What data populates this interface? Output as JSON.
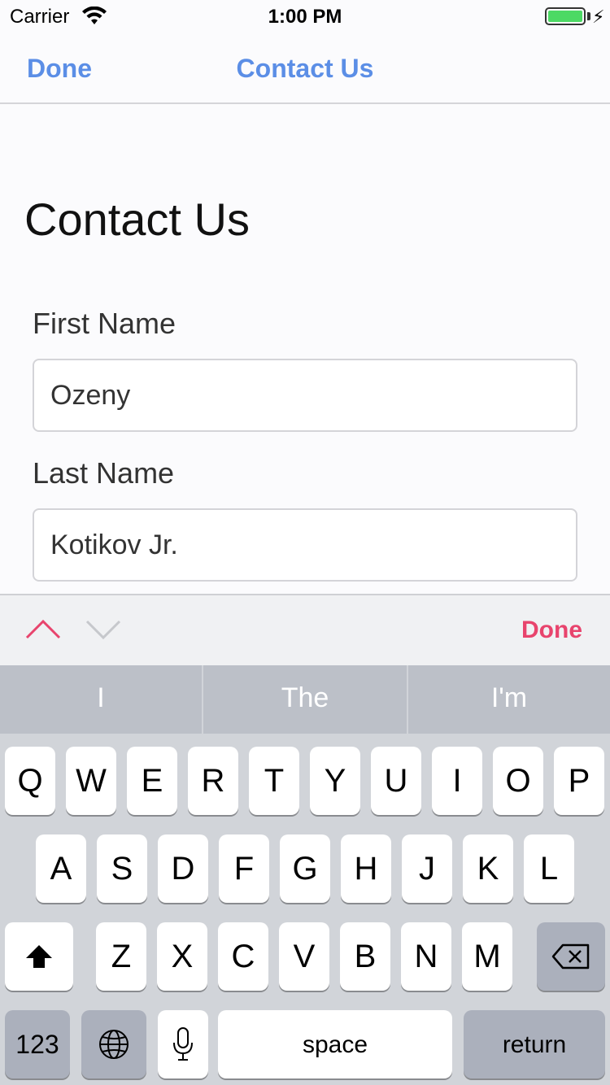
{
  "status_bar": {
    "carrier": "Carrier",
    "time": "1:00 PM",
    "battery_level": 1.0
  },
  "nav": {
    "done_label": "Done",
    "title": "Contact Us"
  },
  "form": {
    "heading": "Contact Us",
    "first_name_label": "First Name",
    "first_name_value": "Ozeny",
    "last_name_label": "Last Name",
    "last_name_value": "Kotikov Jr."
  },
  "accessory": {
    "done_label": "Done",
    "up_icon": "chevron-up-icon",
    "down_icon": "chevron-down-icon"
  },
  "keyboard": {
    "suggestions": [
      "I",
      "The",
      "I'm"
    ],
    "row1": [
      "Q",
      "W",
      "E",
      "R",
      "T",
      "Y",
      "U",
      "I",
      "O",
      "P"
    ],
    "row2": [
      "A",
      "S",
      "D",
      "F",
      "G",
      "H",
      "J",
      "K",
      "L"
    ],
    "row3": [
      "Z",
      "X",
      "C",
      "V",
      "B",
      "N",
      "M"
    ],
    "numbers_label": "123",
    "space_label": "space",
    "return_label": "return"
  },
  "colors": {
    "nav_accent": "#5b8ee6",
    "accessory_accent": "#e8446d",
    "battery": "#4cd964"
  }
}
